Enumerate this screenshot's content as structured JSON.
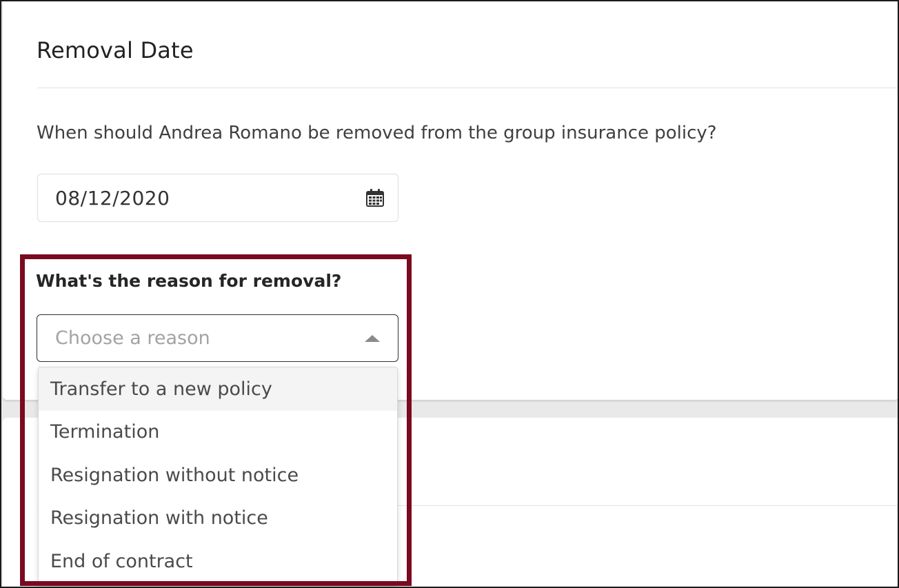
{
  "section": {
    "title": "Removal Date",
    "question": "When should Andrea Romano be removed from the group insurance policy?"
  },
  "date_field": {
    "value": "08/12/2020",
    "icon": "calendar-icon"
  },
  "reason": {
    "label": "What's the reason for removal?",
    "placeholder": "Choose a reason",
    "options": [
      "Transfer to a new policy",
      "Termination",
      "Resignation without notice",
      "Resignation with notice",
      "End of contract"
    ]
  },
  "colors": {
    "highlight": "#7a0a1f",
    "background": "#e9e9e9"
  }
}
